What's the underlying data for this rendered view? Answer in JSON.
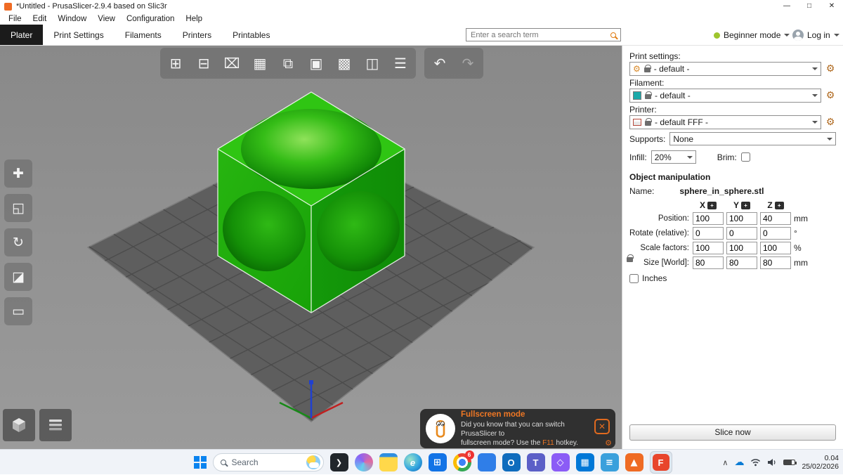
{
  "colors": {
    "accent": "#ed6b21",
    "filament": "#1ba8a8",
    "model_green": "#23c20e"
  },
  "titlebar": {
    "title": "*Untitled - PrusaSlicer-2.9.4 based on Slic3r",
    "minimize": "—",
    "maximize": "□",
    "close": "✕"
  },
  "menubar": {
    "file": "File",
    "edit": "Edit",
    "window": "Window",
    "view": "View",
    "configuration": "Configuration",
    "help": "Help"
  },
  "tabbar": {
    "plater": "Plater",
    "print_settings": "Print Settings",
    "filaments": "Filaments",
    "printers": "Printers",
    "printables": "Printables",
    "search_placeholder": "Enter a search term",
    "mode": "Beginner mode",
    "login": "Log in"
  },
  "toolbar": {
    "glyphs": [
      "⊞",
      "⊟",
      "⌧",
      "▦",
      "⧉",
      "▣",
      "▩",
      "◫",
      "☰"
    ],
    "undo": "↶",
    "redo": "↷"
  },
  "left_toolbar": {
    "move": "✚",
    "scale": "◱",
    "rotate": "↻",
    "flatten": "◪",
    "measure": "▭"
  },
  "sidebar": {
    "print_label": "Print settings:",
    "print_value": "- default -",
    "filament_label": "Filament:",
    "filament_value": "- default -",
    "filament_color": "#1ba8a8",
    "printer_label": "Printer:",
    "printer_value": "- default FFF -",
    "supports_label": "Supports:",
    "supports_value": "None",
    "infill_label": "Infill:",
    "infill_value": "20%",
    "brim_label": "Brim:",
    "gear": "⚙",
    "manip": {
      "title": "Object manipulation",
      "name_label": "Name:",
      "name": "sphere_in_sphere.stl",
      "ax": {
        "x": "X",
        "y": "Y",
        "z": "Z"
      },
      "position": {
        "label": "Position:",
        "x": "100",
        "y": "100",
        "z": "40",
        "unit": "mm"
      },
      "rotate": {
        "label": "Rotate (relative):",
        "x": "0",
        "y": "0",
        "z": "0",
        "unit": "°"
      },
      "scale": {
        "label": "Scale factors:",
        "x": "100",
        "y": "100",
        "z": "100",
        "unit": "%"
      },
      "size": {
        "label": "Size [World]:",
        "x": "80",
        "y": "80",
        "z": "80",
        "unit": "mm"
      },
      "inches": "Inches"
    },
    "slice": "Slice now"
  },
  "notification": {
    "title": "Fullscreen mode",
    "body1": "Did you know that you can switch PrusaSlicer to",
    "body2a": "fullscreen mode? Use the ",
    "hotkey": "F11",
    "body2b": " hotkey.",
    "close": "✕",
    "gear": "⚙"
  },
  "taskbar": {
    "search": "Search",
    "badge": "6",
    "tray_chevron": "∧",
    "cloud": "☁",
    "time": "0.04",
    "date": "25/02/2026",
    "apps": {
      "terminal": "❯",
      "edge": "e",
      "store": "⊞",
      "outlook": "O",
      "teams": "T",
      "code": "◇",
      "calc": "▦",
      "notepad": "≡",
      "prusa": "▲",
      "active": "F"
    }
  }
}
